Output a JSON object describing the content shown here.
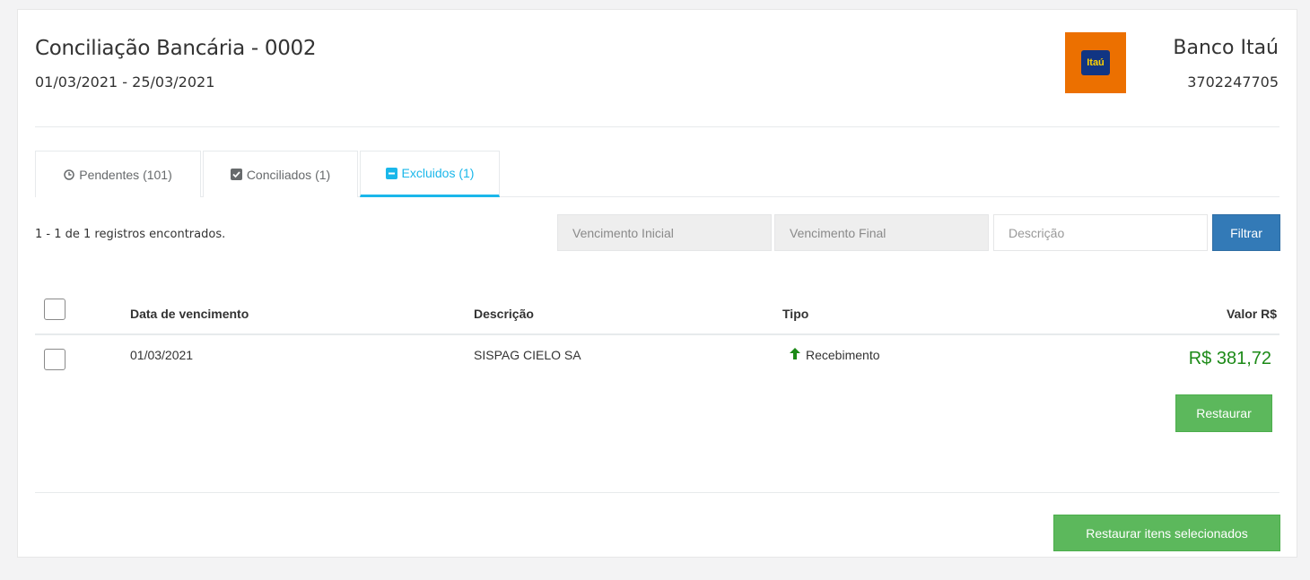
{
  "header": {
    "title": "Conciliação Bancária - 0002",
    "period": "01/03/2021 - 25/03/2021"
  },
  "bank": {
    "name": "Banco Itaú",
    "account": "3702247705",
    "logo_text": "Itaú",
    "logo_bg": "#ec7000",
    "logo_inner": "#113583",
    "logo_text_color": "#ffd200"
  },
  "tabs": [
    {
      "label": "Pendentes (101)",
      "icon": "clock-icon",
      "active": false
    },
    {
      "label": "Conciliados (1)",
      "icon": "check-square-icon",
      "active": false
    },
    {
      "label": "Excluidos (1)",
      "icon": "minus-square-icon",
      "active": true
    }
  ],
  "results": {
    "text": "1 - 1 de 1 registros encontrados."
  },
  "filters": {
    "start_placeholder": "Vencimento Inicial",
    "end_placeholder": "Vencimento Final",
    "desc_placeholder": "Descrição",
    "filter_label": "Filtrar"
  },
  "table": {
    "headers": [
      "Data de vencimento",
      "Descrição",
      "Tipo",
      "Valor R$"
    ],
    "rows": [
      {
        "date": "01/03/2021",
        "description": "SISPAG CIELO SA",
        "type": "Recebimento",
        "type_icon": "arrow-up-icon",
        "value": "R$ 381,72",
        "action_label": "Restaurar"
      }
    ]
  },
  "footer": {
    "restore_selected_label": "Restaurar itens selecionados"
  },
  "colors": {
    "accent": "#1ab7ea",
    "primary": "#337ab7",
    "success": "#5cb85c",
    "income": "#1c8a17"
  }
}
